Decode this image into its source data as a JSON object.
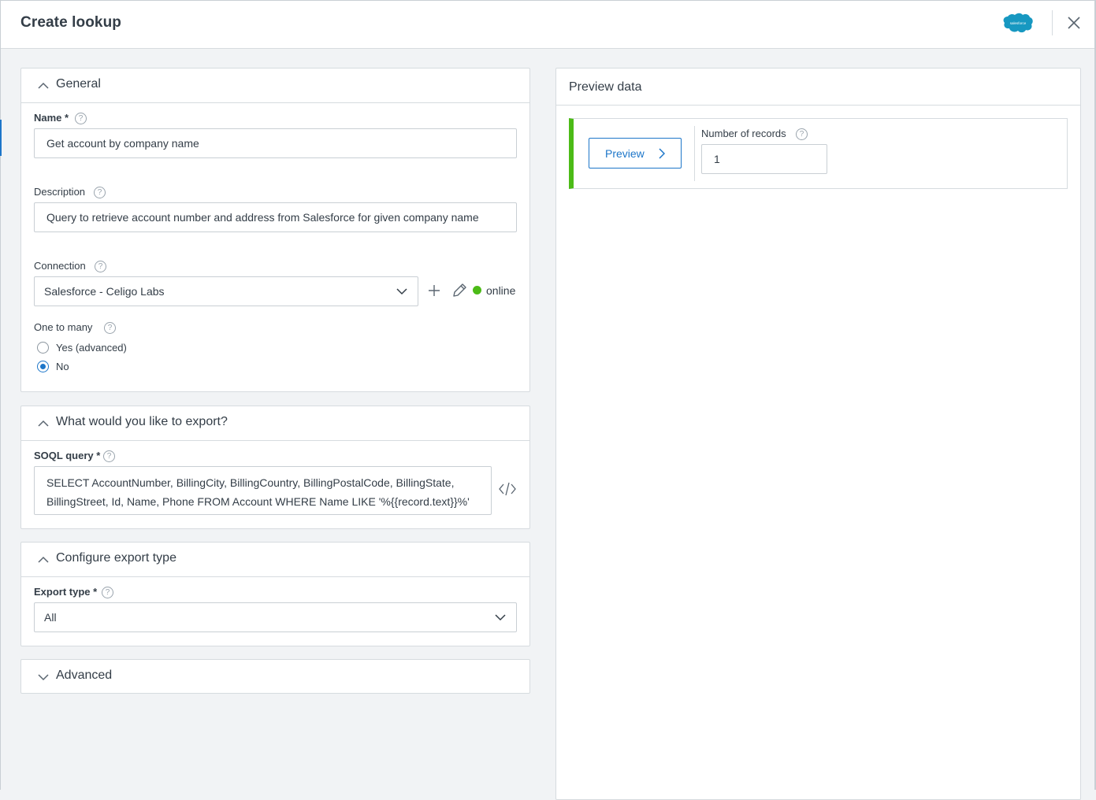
{
  "header": {
    "title": "Create lookup",
    "logo_text": "salesforce",
    "close_icon": "close-icon"
  },
  "general": {
    "title": "General",
    "name_label": "Name",
    "required_mark": "*",
    "name_value": "Get account by company name",
    "description_label": "Description",
    "description_value": "Query to retrieve account number and address from Salesforce for given company name",
    "connection_label": "Connection",
    "connection_value": "Salesforce - Celigo Labs",
    "connection_status": "online",
    "one_to_many_label": "One to many",
    "options": [
      "Yes (advanced)",
      "No"
    ],
    "selected_option": "No",
    "help_glyph": "?"
  },
  "export": {
    "title": "What would you like to export?",
    "soql_label": "SOQL query",
    "soql_line1": "SELECT AccountNumber, BillingCity, BillingCountry, BillingPostalCode, BillingState,",
    "soql_line2": "BillingStreet, Id, Name, Phone FROM Account WHERE Name LIKE '%{{record.text}}%'"
  },
  "export_type": {
    "title": "Configure export type",
    "label": "Export type",
    "value": "All"
  },
  "advanced": {
    "title": "Advanced"
  },
  "preview": {
    "title": "Preview data",
    "button_label": "Preview",
    "records_label": "Number of records",
    "records_value": "1"
  },
  "colors": {
    "accent": "#1d76c9",
    "status_online": "#4cbb17",
    "preview_bar": "#4cbb17",
    "salesforce_blue": "#1798c1"
  }
}
